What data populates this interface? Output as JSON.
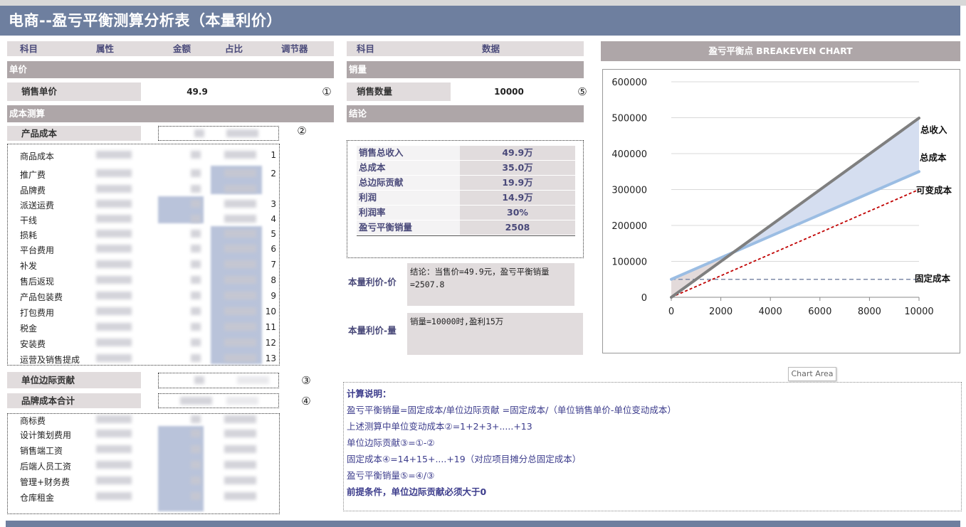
{
  "title": "电商--盈亏平衡测算分析表（本量利价）",
  "left_header": {
    "c1": "科目",
    "c2": "属性",
    "c3": "金额",
    "c4": "占比",
    "c5": "调节器"
  },
  "right_header": {
    "c1": "科目",
    "c2": "数据"
  },
  "unit_price": {
    "section": "单价",
    "label": "销售单价",
    "value": "49.9",
    "marker": "①"
  },
  "cost": {
    "section": "成本测算",
    "product_cost_label": "产品成本",
    "marker": "②",
    "items": [
      {
        "name": "商品成本",
        "num": "1"
      },
      {
        "name": "推广费",
        "num": "2"
      },
      {
        "name": "品牌费",
        "num": ""
      },
      {
        "name": "派送运费",
        "num": "3"
      },
      {
        "name": "干线",
        "num": "4"
      },
      {
        "name": "损耗",
        "num": "5"
      },
      {
        "name": "平台费用",
        "num": "6"
      },
      {
        "name": "补发",
        "num": "7"
      },
      {
        "name": "售后返现",
        "num": "8"
      },
      {
        "name": "产品包装费",
        "num": "9"
      },
      {
        "name": "打包费用",
        "num": "10"
      },
      {
        "name": "税金",
        "num": "11"
      },
      {
        "name": "安装费",
        "num": "12"
      },
      {
        "name": "运营及销售提成",
        "num": "13"
      }
    ],
    "unit_margin_label": "单位边际贡献",
    "unit_margin_marker": "③",
    "brand_total_label": "品牌成本合计",
    "brand_total_marker": "④",
    "fixed_items": [
      {
        "name": "商标费"
      },
      {
        "name": "设计策划费用"
      },
      {
        "name": "销售端工资"
      },
      {
        "name": "后端人员工资"
      },
      {
        "name": "管理+财务费"
      },
      {
        "name": "仓库租金"
      }
    ]
  },
  "volume": {
    "section": "销量",
    "label": "销售数量",
    "value": "10000",
    "marker": "⑤"
  },
  "conclusion": {
    "section": "结论",
    "rows": [
      {
        "k": "销售总收入",
        "v": "49.9万"
      },
      {
        "k": "总成本",
        "v": "35.0万"
      },
      {
        "k": "总边际贡献",
        "v": "19.9万"
      },
      {
        "k": "利润",
        "v": "14.9万"
      },
      {
        "k": "利润率",
        "v": "30%"
      },
      {
        "k": "盈亏平衡销量",
        "v": "2508"
      }
    ]
  },
  "cvp_price": {
    "label": "本量利价-价",
    "line1": "结论：当售价=49.9元，盈亏平衡销量",
    "line2": "=2507.8"
  },
  "cvp_volume": {
    "label": "本量利价-量",
    "text": "销量=10000时,盈利15万"
  },
  "calc_notes": [
    "计算说明：",
    "盈亏平衡销量=固定成本/单位边际贡献  =固定成本/（单位销售单价-单位变动成本）",
    "上述测算中单位变动成本②=1+2+3+.....+13",
    "单位边际贡献③=①-②",
    "固定成本④=14+15+....+19（对应项目摊分总固定成本）",
    "盈亏平衡销量⑤=④/③",
    "前提条件，单位边际贡献必须大于0"
  ],
  "chart_title": "盈亏平衡点  BREAKEVEN CHART",
  "tooltip": "Chart Area",
  "chart_data": {
    "type": "line",
    "x": [
      0,
      10000
    ],
    "xticks": [
      "0",
      "2000",
      "4000",
      "6000",
      "8000",
      "10000"
    ],
    "yticks": [
      "0",
      "100000",
      "200000",
      "300000",
      "400000",
      "500000",
      "600000"
    ],
    "xlim": [
      0,
      10000
    ],
    "ylim": [
      0,
      600000
    ],
    "grid": true,
    "series": [
      {
        "name": "总收入",
        "values": [
          0,
          499000
        ],
        "color": "#7f7f7f"
      },
      {
        "name": "总成本",
        "values": [
          50000,
          350000
        ],
        "color": "#9bbde3"
      },
      {
        "name": "可变成本",
        "values": [
          0,
          300000
        ],
        "color": "#c00000"
      },
      {
        "name": "固定成本",
        "values": [
          50000,
          50000
        ],
        "color": "#7d8aa8"
      }
    ]
  }
}
